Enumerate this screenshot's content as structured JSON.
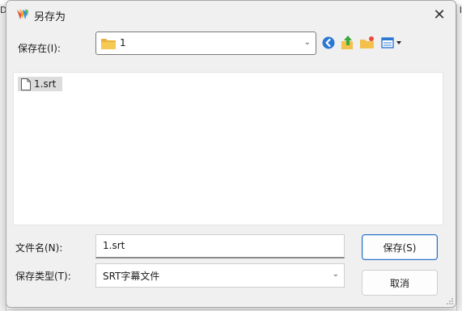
{
  "window": {
    "title": "另存为",
    "close_glyph": "✕"
  },
  "background": {
    "left_glyph": "D:",
    "right_glyph": "I"
  },
  "location": {
    "label": "保存在(I):",
    "value": "1",
    "icon": "folder-icon"
  },
  "toolbar": {
    "back_icon": "back-icon",
    "up_icon": "up-folder-icon",
    "new_folder_icon": "new-folder-icon",
    "view_icon": "view-menu-icon"
  },
  "files": [
    {
      "name": "1.srt",
      "icon": "document-icon",
      "selected": true
    }
  ],
  "filename": {
    "label": "文件名(N):",
    "value": "1.srt"
  },
  "filetype": {
    "label": "保存类型(T):",
    "value": "SRT字幕文件"
  },
  "buttons": {
    "save_label": "保存(S)",
    "cancel_label": "取消"
  },
  "colors": {
    "accent": "#2a6fc4",
    "folder": "#f2c04b",
    "selection": "#dcdcdc"
  }
}
